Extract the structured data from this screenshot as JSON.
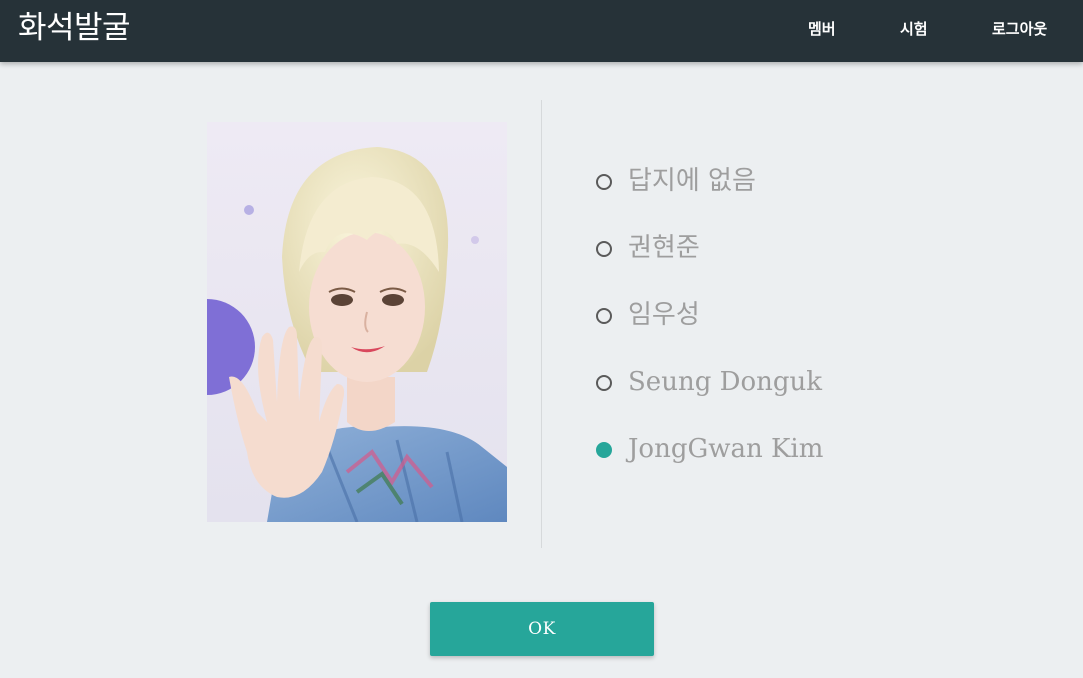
{
  "navbar": {
    "brand": "화석발굴",
    "links": [
      "멤버",
      "시험",
      "로그아웃"
    ]
  },
  "quiz": {
    "photo_icon": "person-photo-icon",
    "options": [
      {
        "label": "답지에 없음",
        "selected": false
      },
      {
        "label": "권현준",
        "selected": false
      },
      {
        "label": "임우성",
        "selected": false
      },
      {
        "label": "Seung Donguk",
        "selected": false
      },
      {
        "label": "JongGwan Kim",
        "selected": true
      }
    ],
    "ok_label": "OK"
  },
  "colors": {
    "navbar_bg": "#263238",
    "page_bg": "#eceff1",
    "accent": "#26a69a",
    "option_text": "#9e9e9e"
  }
}
